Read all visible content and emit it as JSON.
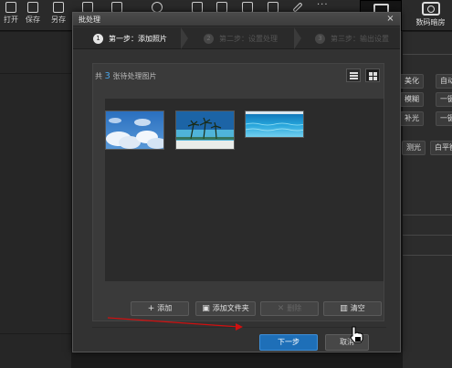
{
  "toolbar": {
    "items": [
      {
        "label": "打开",
        "icon": "open-icon"
      },
      {
        "label": "保存",
        "icon": "save-icon"
      },
      {
        "label": "另存",
        "icon": "save-as-icon"
      },
      {
        "label": "",
        "icon": "size-icon"
      },
      {
        "label": "",
        "icon": "crop-icon"
      },
      {
        "label": "",
        "icon": "rotate-icon"
      },
      {
        "label": "",
        "icon": "frame-icon"
      },
      {
        "label": "",
        "icon": "layout-icon"
      },
      {
        "label": "",
        "icon": "grid-icon"
      },
      {
        "label": "",
        "icon": "print-icon"
      },
      {
        "label": "",
        "icon": "brush-icon"
      }
    ],
    "more": "···",
    "camera_label": "数码暗房"
  },
  "right_panel": {
    "buttons": [
      "美化",
      "自动",
      "模糊",
      "一键",
      "补光",
      "一键",
      "测光",
      "白平衡"
    ]
  },
  "dialog": {
    "title": "批处理",
    "close": "×",
    "steps": [
      {
        "num": "1",
        "label": "第一步：添加照片",
        "state": "active"
      },
      {
        "num": "2",
        "label": "第二步：设置处理",
        "state": "inactive"
      },
      {
        "num": "3",
        "label": "第三步：输出设置",
        "state": "inactive"
      }
    ],
    "count_prefix": "共",
    "count": "3",
    "count_suffix": "张待处理图片",
    "thumbnails": [
      {
        "name": "sky-clouds-thumbnail",
        "colors": [
          "#2f78c4",
          "#9fc3e6",
          "#ffffff"
        ]
      },
      {
        "name": "beach-palms-thumbnail",
        "colors": [
          "#1d6aa8",
          "#56b7d8",
          "#e8e8e8"
        ]
      },
      {
        "name": "sea-water-thumbnail",
        "colors": [
          "#0d72b6",
          "#31aee0",
          "#9fe0f4"
        ]
      }
    ],
    "buttons": {
      "add": "添加",
      "add_folder": "添加文件夹",
      "delete": "删除",
      "clear": "清空"
    },
    "next": "下一步",
    "cancel": "取消"
  },
  "colors": {
    "accent": "#1e6fb8",
    "count_highlight": "#4aa3e6",
    "annotation_arrow": "#d01010"
  }
}
